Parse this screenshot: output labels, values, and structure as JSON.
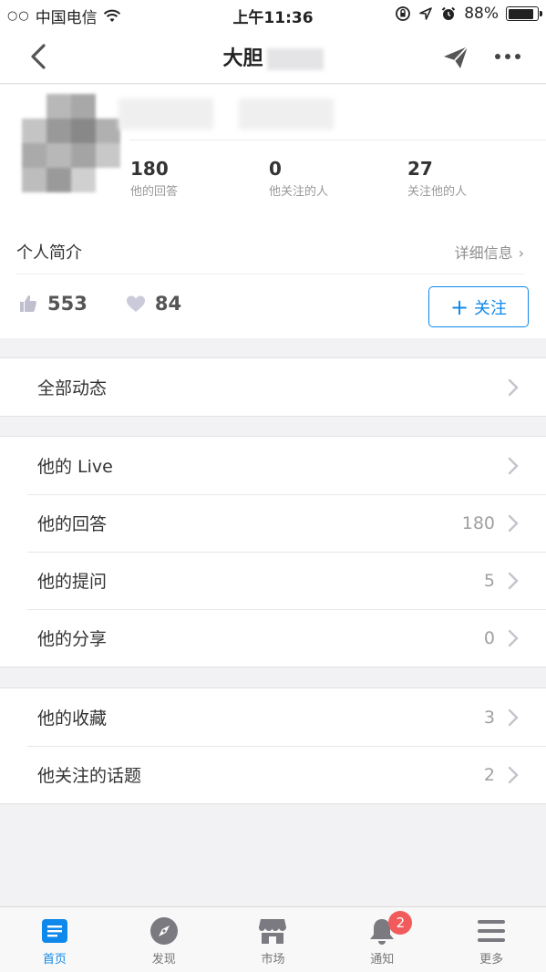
{
  "status_bar": {
    "signal_dots": "○○",
    "carrier": "中国电信",
    "time": "上午11:36",
    "battery_percent": "88%",
    "battery_level": 0.88
  },
  "navbar": {
    "title": "大胆"
  },
  "profile": {
    "stats": [
      {
        "num": "180",
        "label": "他的回答"
      },
      {
        "num": "0",
        "label": "他关注的人"
      },
      {
        "num": "27",
        "label": "关注他的人"
      }
    ],
    "intro_label": "个人简介",
    "detail_link": "详细信息",
    "detail_chevron": "›",
    "likes_count": "553",
    "hearts_count": "84",
    "follow_button": {
      "plus": "+",
      "label": "关注"
    }
  },
  "groups": [
    {
      "rows": [
        {
          "label": "全部动态",
          "count": ""
        }
      ]
    },
    {
      "rows": [
        {
          "label": "他的 Live",
          "count": ""
        },
        {
          "label": "他的回答",
          "count": "180"
        },
        {
          "label": "他的提问",
          "count": "5"
        },
        {
          "label": "他的分享",
          "count": "0"
        }
      ]
    },
    {
      "rows": [
        {
          "label": "他的收藏",
          "count": "3"
        },
        {
          "label": "他关注的话题",
          "count": "2"
        }
      ]
    }
  ],
  "tabbar": {
    "tabs": [
      {
        "label": "首页",
        "icon": "home-feed-icon"
      },
      {
        "label": "发现",
        "icon": "compass-icon"
      },
      {
        "label": "市场",
        "icon": "store-icon"
      },
      {
        "label": "通知",
        "icon": "bell-icon"
      },
      {
        "label": "更多",
        "icon": "menu-icon"
      }
    ],
    "notification_badge": "2"
  },
  "colors": {
    "accent": "#0f88eb",
    "badge": "#f25b5b",
    "background": "#f2f2f4"
  }
}
